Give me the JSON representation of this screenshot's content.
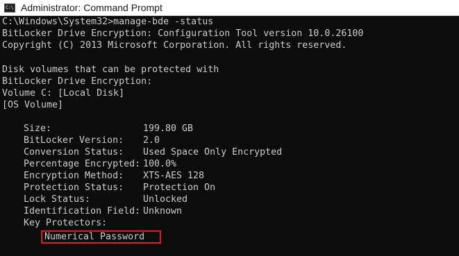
{
  "window": {
    "title": "Administrator: Command Prompt",
    "icon": "command-prompt-icon",
    "icon_glyph": "C:\\",
    "background": "#0c0c0c",
    "text_color": "#cccccc",
    "highlight_color": "#e21a1a"
  },
  "console": {
    "prompt_line": "C:\\Windows\\System32>manage-bde -status",
    "tool_line": "BitLocker Drive Encryption: Configuration Tool version 10.0.26100",
    "copyright_line": "Copyright (C) 2013 Microsoft Corporation. All rights reserved.",
    "intro_line_1": "Disk volumes that can be protected with",
    "intro_line_2": "BitLocker Drive Encryption:",
    "volume_line": "Volume C: [Local Disk]",
    "volume_type_line": "[OS Volume]",
    "status_fields": [
      {
        "key": "Size:",
        "value": "199.80 GB"
      },
      {
        "key": "BitLocker Version:",
        "value": "2.0"
      },
      {
        "key": "Conversion Status:",
        "value": "Used Space Only Encrypted"
      },
      {
        "key": "Percentage Encrypted:",
        "value": "100.0%"
      },
      {
        "key": "Encryption Method:",
        "value": "XTS-AES 128"
      },
      {
        "key": "Protection Status:",
        "value": "Protection On"
      },
      {
        "key": "Lock Status:",
        "value": "Unlocked"
      },
      {
        "key": "Identification Field:",
        "value": "Unknown"
      }
    ],
    "key_protectors_label": "Key Protectors:",
    "key_protector_item": "Numerical Password"
  }
}
